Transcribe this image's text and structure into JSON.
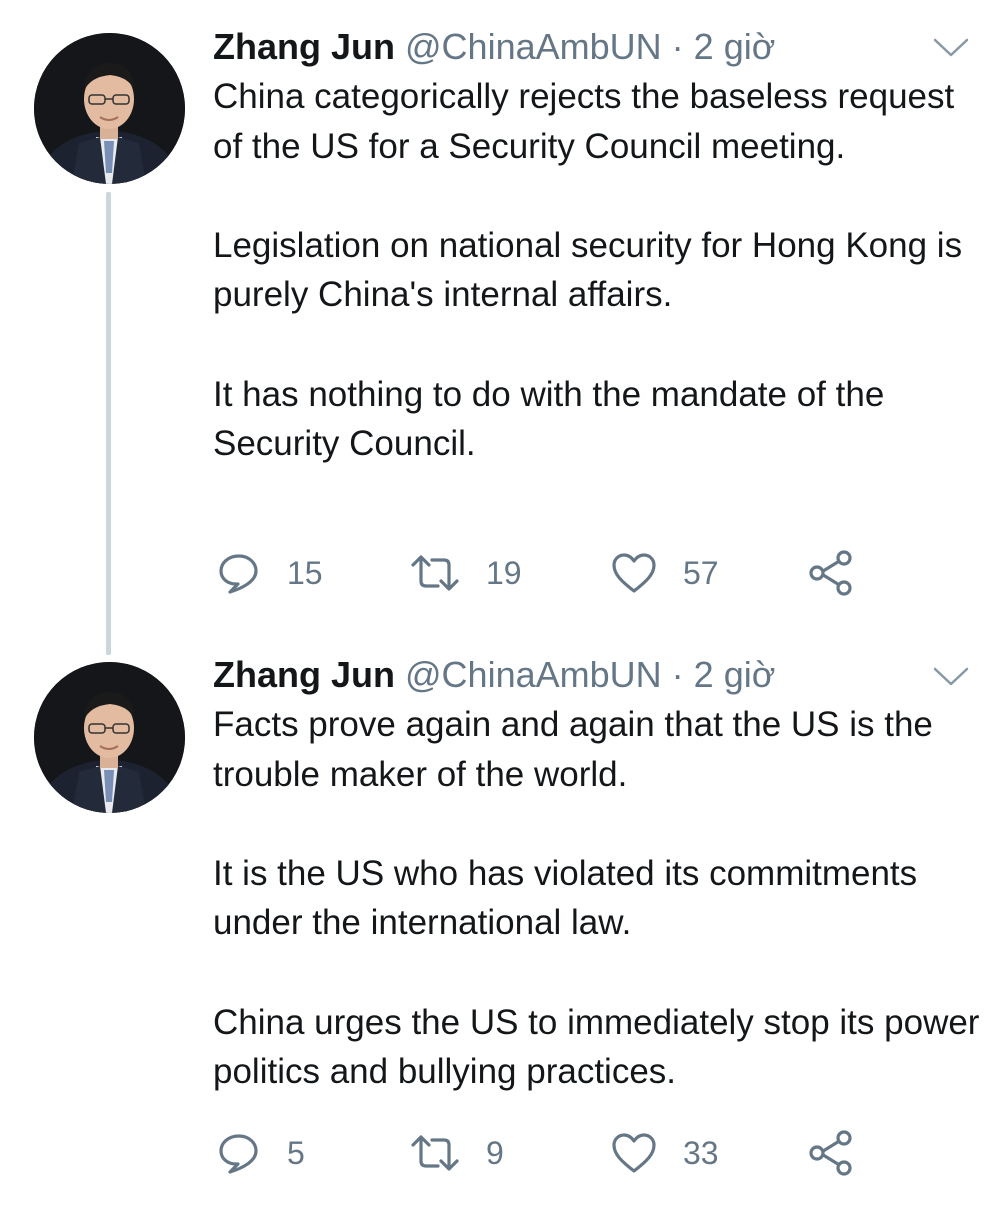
{
  "thread": {
    "tweets": [
      {
        "author_name": "Zhang Jun",
        "handle": "@ChinaAmbUN",
        "separator": "·",
        "time": "2 giờ",
        "paragraphs": [
          "China categorically rejects the baseless request of the US for a Security Council meeting.",
          "Legislation on national security for Hong Kong is purely China's internal affairs.",
          "It has nothing to do with the mandate of the Security Council."
        ],
        "replies": "15",
        "retweets": "19",
        "likes": "57"
      },
      {
        "author_name": "Zhang Jun",
        "handle": "@ChinaAmbUN",
        "separator": "·",
        "time": "2 giờ",
        "paragraphs": [
          "Facts prove again and again that the US is the trouble maker of the world.",
          "It is the US who has violated its commitments under the international law.",
          "China urges the US to immediately stop its power politics and bullying practices."
        ],
        "replies": "5",
        "retweets": "9",
        "likes": "33"
      }
    ]
  },
  "icons": {
    "reply": "reply-icon",
    "retweet": "retweet-icon",
    "like": "heart-icon",
    "share": "share-icon",
    "menu": "chevron-down-icon"
  },
  "colors": {
    "text": "#14171a",
    "secondary": "#657786",
    "thread_line": "#ccd6dd",
    "icon": "#657786"
  }
}
